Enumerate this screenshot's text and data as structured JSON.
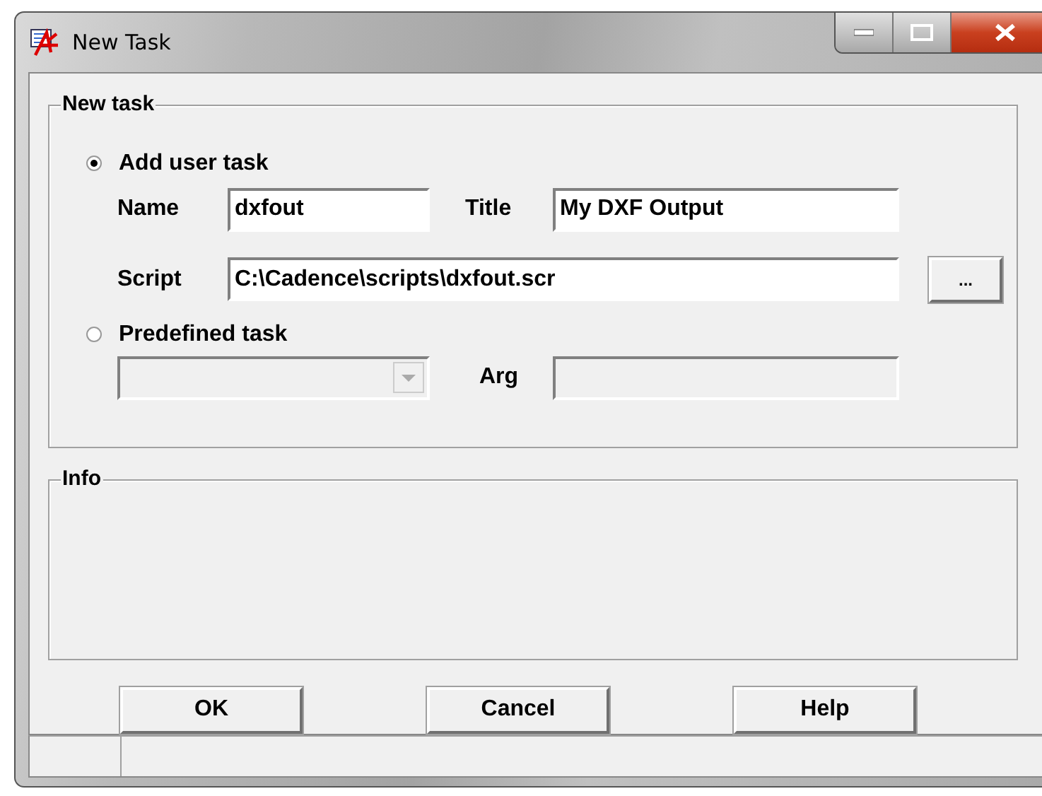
{
  "window": {
    "title": "New Task"
  },
  "new_task_group": {
    "legend": "New task",
    "user_task": {
      "label": "Add user task",
      "selected": true,
      "name": {
        "label": "Name",
        "value": "dxfout"
      },
      "title": {
        "label": "Title",
        "value": "My DXF Output"
      },
      "script": {
        "label": "Script",
        "value": "C:\\Cadence\\scripts\\dxfout.scr",
        "browse": "..."
      }
    },
    "predefined_task": {
      "label": "Predefined task",
      "selected": false,
      "task_combo": {
        "disabled": true
      },
      "arg": {
        "label": "Arg",
        "disabled": true
      }
    }
  },
  "info_group": {
    "legend": "Info"
  },
  "buttons": [
    "OK",
    "Cancel",
    "Help"
  ]
}
